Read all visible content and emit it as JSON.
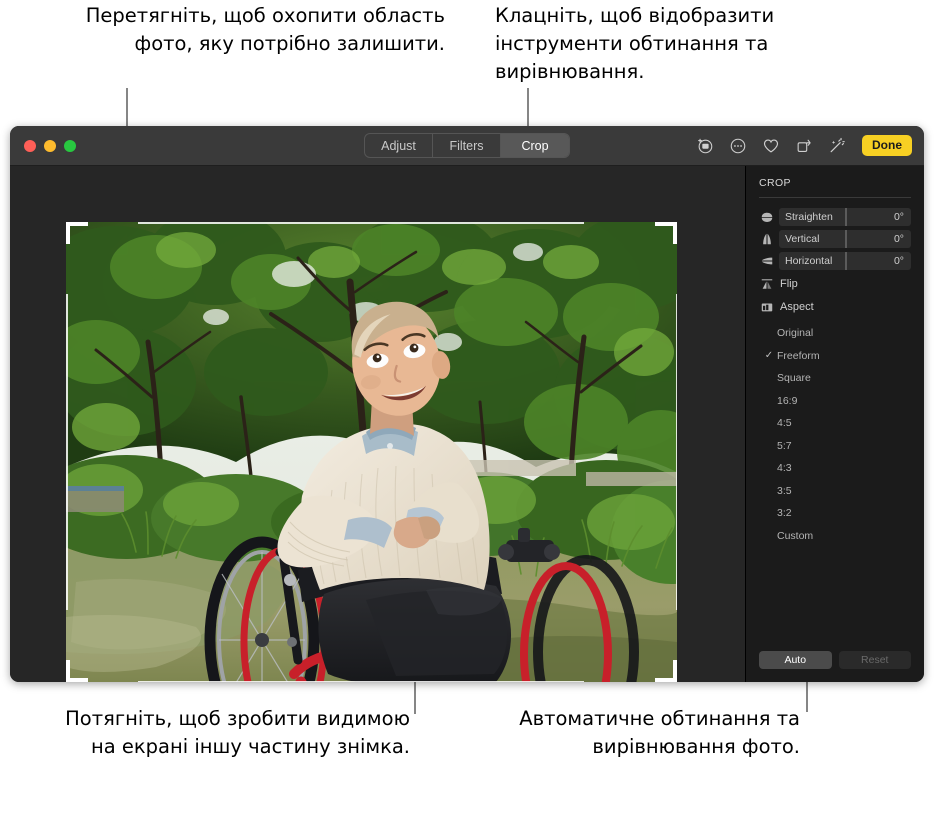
{
  "callouts": {
    "crop_area": "Перетягніть, щоб охопити область фото, яку потрібно залишити.",
    "crop_tools": "Клацніть, щоб відобразити інструменти обтинання та вирівнювання.",
    "drag_photo": "Потягніть, щоб зробити видимою на екрані іншу частину знімка.",
    "auto": "Автоматичне обтинання та вирівнювання фото."
  },
  "window": {
    "traffic_lights": [
      "close",
      "minimize",
      "maximize"
    ]
  },
  "segmented_control": {
    "items": [
      {
        "label": "Adjust",
        "selected": false
      },
      {
        "label": "Filters",
        "selected": false
      },
      {
        "label": "Crop",
        "selected": true
      }
    ]
  },
  "toolbar": {
    "icons": [
      "revert-to-original-icon",
      "more-options-icon",
      "favorite-heart-icon",
      "rotate-icon",
      "auto-enhance-wand-icon"
    ],
    "done_label": "Done",
    "done_color": "#f7d023"
  },
  "sidebar": {
    "header": "CROP",
    "sliders": [
      {
        "icon": "straighten-icon",
        "label": "Straighten",
        "value": "0°"
      },
      {
        "icon": "vertical-icon",
        "label": "Vertical",
        "value": "0°"
      },
      {
        "icon": "horizontal-icon",
        "label": "Horizontal",
        "value": "0°"
      }
    ],
    "menus": [
      {
        "icon": "flip-icon",
        "label": "Flip"
      },
      {
        "icon": "aspect-icon",
        "label": "Aspect"
      }
    ],
    "aspect_options": [
      {
        "label": "Original",
        "checked": false
      },
      {
        "label": "Freeform",
        "checked": true
      },
      {
        "label": "Square",
        "checked": false
      },
      {
        "label": "16:9",
        "checked": false
      },
      {
        "label": "4:5",
        "checked": false
      },
      {
        "label": "5:7",
        "checked": false
      },
      {
        "label": "4:3",
        "checked": false
      },
      {
        "label": "3:5",
        "checked": false
      },
      {
        "label": "3:2",
        "checked": false
      },
      {
        "label": "Custom",
        "checked": false
      }
    ],
    "check_glyph": "✓",
    "auto_label": "Auto",
    "reset_label": "Reset"
  },
  "photo": {
    "description": "Man in a wheelchair in a green garden looking up and smiling",
    "crop_handles": [
      "top-left",
      "top-right",
      "bottom-left",
      "bottom-right"
    ]
  },
  "colors": {
    "window_bg": "#262626",
    "titlebar_bg": "#3a3a3a",
    "sidebar_bg": "#1b1b1b",
    "accent": "#f7d023"
  }
}
